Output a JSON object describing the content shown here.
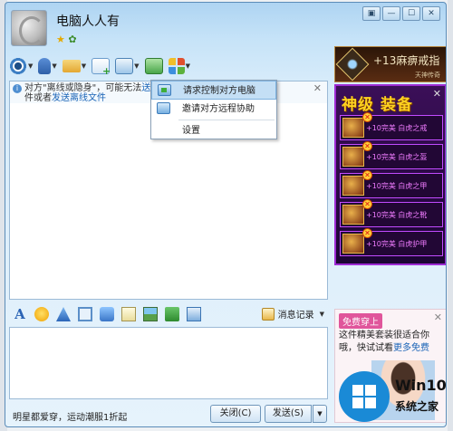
{
  "window": {
    "contact_name": "电脑人人有",
    "controls": [
      "▣",
      "—",
      "☐",
      "✕"
    ]
  },
  "notice": {
    "text_1": "对方\"离线或隐身\"，可能无法",
    "link_1": "送邮",
    "text_2": "件或者",
    "link_2": "发送离线文件"
  },
  "context_menu": {
    "items": [
      {
        "label": "请求控制对方电脑",
        "highlighted": true
      },
      {
        "label": "邀请对方远程协助",
        "highlighted": false
      },
      {
        "label": "设置",
        "highlighted": false
      }
    ]
  },
  "ad_top": {
    "title": "+13麻痹戒指",
    "subtitle": "天神传奇"
  },
  "ad_equip": {
    "title": "神级 装备",
    "items": [
      {
        "label": "+10完美 白虎之戒"
      },
      {
        "label": "+10完美 白虎之盔"
      },
      {
        "label": "+10完美 白虎之甲"
      },
      {
        "label": "+10完美 白虎之靴"
      },
      {
        "label": "+10完美 白虎护甲"
      }
    ]
  },
  "input_toolbar": {
    "history_label": "消息记录"
  },
  "bottom_bar": {
    "ad_text": "明星都爱穿，运动潮服1折起",
    "close_label": "关闭(C)",
    "send_label": "发送(S)"
  },
  "ad_fashion": {
    "tag": "免费穿上",
    "text_1": "这件精美套装很适合你哦，快试试看",
    "link": "更多免费"
  },
  "watermark": {
    "line_1": "Win10",
    "line_2": "系统之家"
  },
  "colors": {
    "window_border": "#5b8cb8",
    "link": "#1a64b7",
    "menu_highlight": "#c4dff5",
    "equip_border": "#9d2bd4",
    "equip_title": "#ffd21f",
    "watermark_blue": "#1a8ad6"
  }
}
